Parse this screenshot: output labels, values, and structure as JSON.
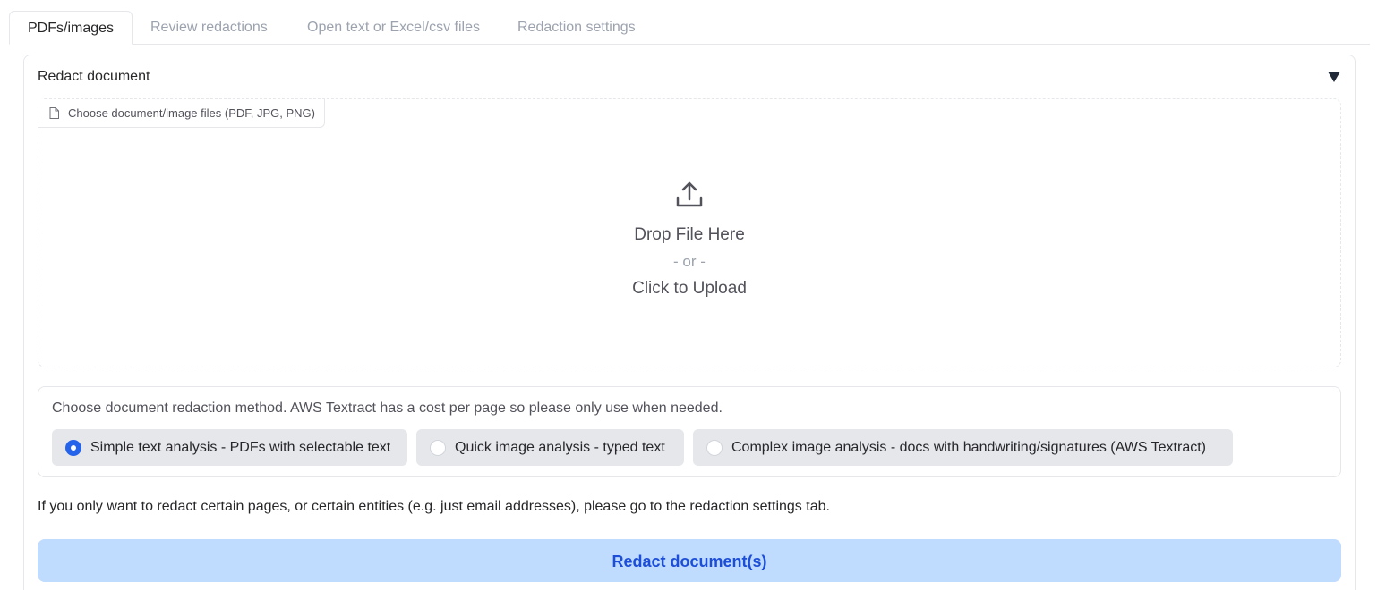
{
  "tabs": [
    {
      "label": "PDFs/images",
      "active": true
    },
    {
      "label": "Review redactions",
      "active": false
    },
    {
      "label": "Open text or Excel/csv files",
      "active": false
    },
    {
      "label": "Redaction settings",
      "active": false
    }
  ],
  "panel": {
    "title": "Redact document",
    "collapse_icon": "triangle-down-icon"
  },
  "upload": {
    "label": "Choose document/image files (PDF, JPG, PNG)",
    "label_icon": "file-icon",
    "upload_icon": "upload-icon",
    "drop_text": "Drop File Here",
    "or_text": "- or -",
    "click_text": "Click to Upload"
  },
  "method": {
    "label": "Choose document redaction method. AWS Textract has a cost per page so please only use when needed.",
    "options": [
      {
        "label": "Simple text analysis - PDFs with selectable text",
        "selected": true
      },
      {
        "label": "Quick image analysis - typed text",
        "selected": false
      },
      {
        "label": "Complex image analysis - docs with handwriting/signatures (AWS Textract)",
        "selected": false
      }
    ]
  },
  "info_text": "If you only want to redact certain pages, or certain entities (e.g. just email addresses), please go to the redaction settings tab.",
  "redact_button_label": "Redact document(s)",
  "colors": {
    "accent": "#2563eb",
    "button_bg": "#bfdbfe",
    "button_text": "#1d4ed8",
    "border": "#e5e7eb"
  }
}
